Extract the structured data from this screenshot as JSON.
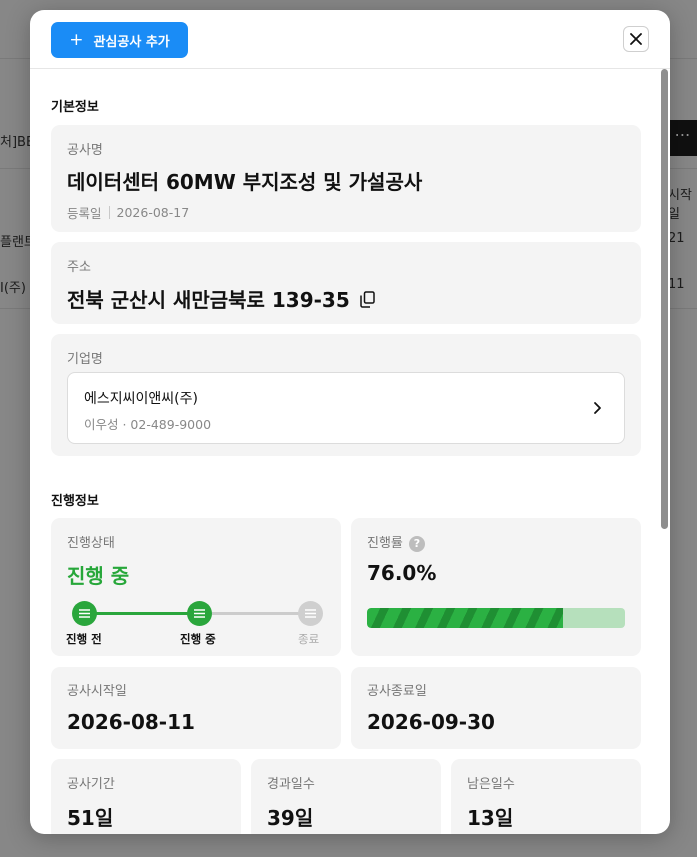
{
  "background": {
    "cells": [
      "처]BB",
      "플랜트",
      "I(주)",
      "시작일",
      "21",
      "11"
    ]
  },
  "header": {
    "add_button_label": "관심공사 추가",
    "add_icon": "plus-icon",
    "close_icon": "close-icon"
  },
  "basic_info": {
    "section_title": "기본정보",
    "project": {
      "label": "공사명",
      "name": "데이터센터 60MW 부지조성 및 가설공사",
      "registered_label": "등록일",
      "registered_date": "2026-08-17"
    },
    "address": {
      "label": "주소",
      "value": "전북 군산시 새만금북로 139-35",
      "copy_icon": "copy-icon"
    },
    "company": {
      "label": "기업명",
      "name": "에스지씨이앤씨(주)",
      "contact": "이우성 · 02-489-9000",
      "chevron_icon": "chevron-right-icon"
    }
  },
  "progress_info": {
    "section_title": "진행정보",
    "status": {
      "label": "진행상태",
      "value": "진행 중",
      "steps": [
        "진행 전",
        "진행 중",
        "종료"
      ],
      "current_step": 1
    },
    "rate": {
      "label": "진행률",
      "value_text": "76.0%",
      "percent": 76.0,
      "help_icon": "help-icon"
    },
    "start": {
      "label": "공사시작일",
      "value": "2026-08-11"
    },
    "end": {
      "label": "공사종료일",
      "value": "2026-09-30"
    },
    "period": {
      "label": "공사기간",
      "value": "51일"
    },
    "elapsed": {
      "label": "경과일수",
      "value": "39일"
    },
    "remaining": {
      "label": "남은일수",
      "value": "13일"
    }
  },
  "colors": {
    "primary": "#1a8cf6",
    "success": "#27a73a",
    "progress_track": "#b6e0bc",
    "card_bg": "#f4f4f4"
  }
}
